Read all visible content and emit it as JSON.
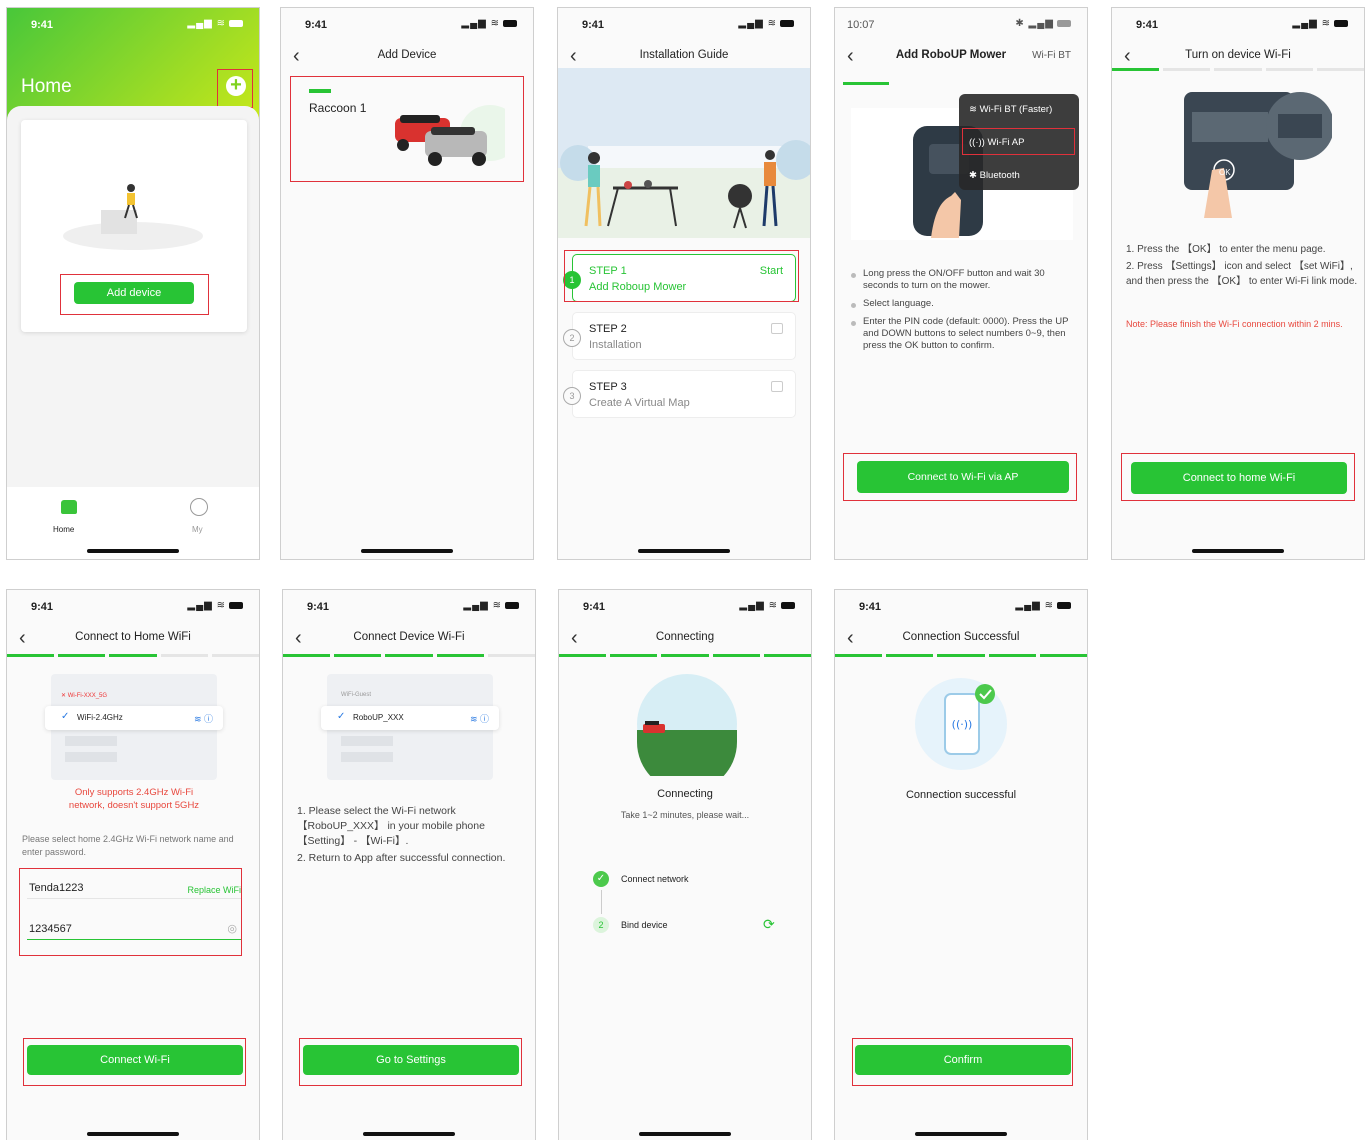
{
  "status": {
    "time": "9:41",
    "time_alt": "10:07"
  },
  "s1": {
    "title": "Home",
    "add_device": "Add device",
    "tab_home": "Home",
    "tab_my": "My"
  },
  "s2": {
    "title": "Add Device",
    "device_name": "Raccoon 1"
  },
  "s3": {
    "title": "Installation Guide",
    "steps": [
      {
        "num": "1",
        "label": "STEP 1",
        "desc": "Add Roboup Mower",
        "action": "Start"
      },
      {
        "num": "2",
        "label": "STEP 2",
        "desc": "Installation"
      },
      {
        "num": "3",
        "label": "STEP 3",
        "desc": "Create A Virtual Map"
      }
    ]
  },
  "s4": {
    "title": "Add RoboUP Mower",
    "mode": "Wi-Fi BT",
    "menu": [
      "Wi-Fi BT (Faster)",
      "Wi-Fi AP",
      "Bluetooth"
    ],
    "bullets": [
      "Long press the ON/OFF button and wait 30 seconds to turn on the mower.",
      "Select language.",
      "Enter the PIN code (default: 0000). Press the UP and DOWN buttons to select numbers 0~9, then press the OK button to confirm."
    ],
    "button": "Connect to Wi-Fi via AP"
  },
  "s5": {
    "title": "Turn on device Wi-Fi",
    "steps": [
      "1. Press the 【OK】 to enter the menu page.",
      "2. Press 【Settings】 icon and select 【set WiFi】, and then press the 【OK】 to enter Wi-Fi link mode."
    ],
    "note": "Note: Please finish the Wi-Fi connection within 2 mins.",
    "button": "Connect to home Wi-Fi",
    "ok": "OK"
  },
  "s6": {
    "title": "Connect to Home WiFi",
    "ssid_bad": "Wi-Fi-XXX_5G",
    "ssid": "WiFi-2.4GHz",
    "warning": "Only supports 2.4GHz Wi-Fi network, doesn't support 5GHz",
    "hint": "Please select home 2.4GHz Wi-Fi network name and enter password.",
    "wifi_name": "Tenda1223",
    "replace": "Replace WiFi",
    "password": "1234567",
    "button": "Connect Wi-Fi"
  },
  "s7": {
    "title": "Connect Device Wi-Fi",
    "ssid_other": "WiFi-Guest",
    "ssid": "RoboUP_XXX",
    "steps": [
      "1. Please select the Wi-Fi network 【RoboUP_XXX】 in your mobile phone 【Setting】 - 【Wi-Fi】.",
      "2. Return to App after successful connection."
    ],
    "button": "Go to Settings"
  },
  "s8": {
    "title": "Connecting",
    "status": "Connecting",
    "sub": "Take 1~2 minutes, please wait...",
    "task1": "Connect network",
    "task2_num": "2",
    "task2": "Bind device"
  },
  "s9": {
    "title": "Connection Successful",
    "status": "Connection successful",
    "button": "Confirm"
  }
}
